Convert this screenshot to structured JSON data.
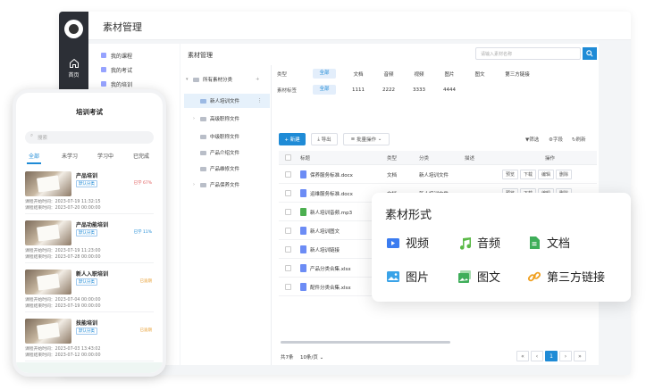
{
  "desktop": {
    "app_title": "素材管理",
    "nav_home": "首页",
    "menu": [
      "我的课程",
      "我的考试",
      "我的培训"
    ],
    "panel_title": "素材管理",
    "search_placeholder": "请输入素材名称",
    "tree": {
      "root": "所有素材分类",
      "items": [
        "新人培训文件",
        "高级职称文件",
        "中级职称文件",
        "产品介绍文件",
        "产品维修文件",
        "产品保养文件"
      ]
    },
    "filters": {
      "type_label": "类型",
      "count_label": "素材标签",
      "all_label": "全部",
      "columns": [
        "文档",
        "音频",
        "视频",
        "图片",
        "图文",
        "第三方链接"
      ],
      "counts": [
        "1111",
        "2222",
        "3333",
        "4444"
      ]
    },
    "toolbar": {
      "add": "+ 新建",
      "export": "导出",
      "batch": "批量操作",
      "filter": "筛选",
      "field": "字段",
      "refresh": "刷新"
    },
    "table": {
      "headers": {
        "title": "标题",
        "type": "类型",
        "category": "分类",
        "desc": "描述",
        "ops": "操作"
      },
      "rows": [
        {
          "name": "保养服务标准.docx",
          "type": "文档",
          "category": "新人培训文件",
          "icon_color": "#6c8cf5"
        },
        {
          "name": "运维服务标准.docx",
          "type": "文档",
          "category": "新人培训文件",
          "icon_color": "#6c8cf5"
        },
        {
          "name": "新人培训音频.mp3",
          "type": "",
          "category": "",
          "icon_color": "#4caf50"
        },
        {
          "name": "新人培训图文",
          "type": "",
          "category": "",
          "icon_color": "#6c8cf5"
        },
        {
          "name": "新人培训链接",
          "type": "",
          "category": "",
          "icon_color": "#6c8cf5"
        },
        {
          "name": "产品分类合集.xlsx",
          "type": "",
          "category": "",
          "icon_color": "#6c8cf5"
        },
        {
          "name": "配件分类合集.xlsx",
          "type": "",
          "category": "",
          "icon_color": "#6c8cf5"
        }
      ],
      "op_labels": [
        "预览",
        "下载",
        "编辑",
        "删除"
      ]
    },
    "pager": {
      "total": "共7条",
      "size": "10条/页",
      "current": "1"
    }
  },
  "phone": {
    "title": "培训考试",
    "search_placeholder": "搜索",
    "tabs": [
      "全部",
      "未学习",
      "学习中",
      "已完成"
    ],
    "cards": [
      {
        "title": "产品培训",
        "tag": "默认分类",
        "status": "已学 67%",
        "status_color": "#e05a5a",
        "start": "课程开始时间：2023-07-19 11:32:15",
        "end": "课程结束时间：2023-07-20 00:00:00"
      },
      {
        "title": "产品功能培训",
        "tag": "默认分类",
        "status": "已学 11%",
        "status_color": "#1f8bd6",
        "start": "课程开始时间：2023-07-19 11:23:00",
        "end": "课程结束时间：2023-07-28 00:00:00"
      },
      {
        "title": "新人入职培训",
        "tag": "默认分类",
        "status": "已逾期",
        "status_color": "#e8a23a",
        "start": "课程开始时间：2023-07-04 00:00:00",
        "end": "课程结束时间：2023-07-19 00:00:00"
      },
      {
        "title": "技能培训",
        "tag": "默认分类",
        "status": "已逾期",
        "status_color": "#e8a23a",
        "start": "课程开始时间：2023-07-03 13:43:02",
        "end": "课程结束时间：2023-07-12 00:00:00"
      }
    ]
  },
  "popup": {
    "title": "素材形式",
    "items": [
      {
        "label": "视频",
        "icon": "video-icon",
        "color": "#3b7cf0"
      },
      {
        "label": "音频",
        "icon": "music-icon",
        "color": "#5ab946"
      },
      {
        "label": "文档",
        "icon": "document-icon",
        "color": "#3fae5a"
      },
      {
        "label": "图片",
        "icon": "image-icon",
        "color": "#3aa3e8"
      },
      {
        "label": "图文",
        "icon": "image-text-icon",
        "color": "#3fae5a"
      },
      {
        "label": "第三方链接",
        "icon": "link-icon",
        "color": "#f0a020"
      }
    ]
  }
}
